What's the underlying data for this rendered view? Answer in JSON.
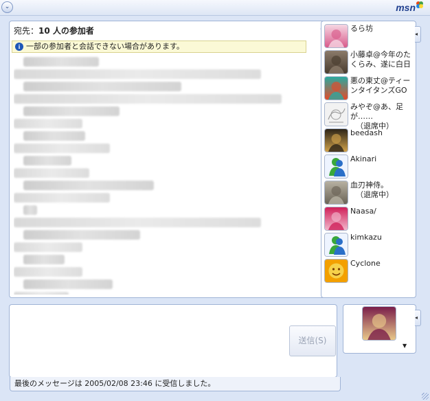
{
  "window": {
    "menu_glyph": "⌄",
    "logo": "msn"
  },
  "conversation": {
    "to_prefix": "宛先：",
    "to_value": "10 人の参加者",
    "warning_icon_glyph": "i",
    "warning": "一部の参加者と会話できない場合があります。"
  },
  "participants": [
    {
      "name": "るら坊",
      "status": "",
      "avatar": "anime-girl-pink-hair-icon",
      "colors": [
        "#f6d7e3",
        "#d85b8b"
      ]
    },
    {
      "name": "小藤卓@今年のたくらみ、遂に白日",
      "status": "",
      "avatar": "photo-scene-icon",
      "colors": [
        "#8b7a6a",
        "#4a3d30"
      ]
    },
    {
      "name": "悪の東丈@ティーンタイタンズGO",
      "status": "",
      "avatar": "cartoon-character-icon",
      "colors": [
        "#2aa9a0",
        "#e34a2a"
      ]
    },
    {
      "name": "みやぞ@あ、足が……",
      "status": "（退席中）",
      "avatar": "sketch-drawing-icon",
      "colors": [
        "#f2f2f2",
        "#9a9a9a"
      ]
    },
    {
      "name": "beedash",
      "status": "",
      "avatar": "pharaoh-mask-icon",
      "colors": [
        "#2c2418",
        "#d0a24a"
      ]
    },
    {
      "name": "Akinari",
      "status": "",
      "avatar": "msn-buddy-icon",
      "colors": [
        "#3aa83a",
        "#2a6fc8"
      ]
    },
    {
      "name": "血刃神侍。",
      "status": "（退席中）",
      "avatar": "cat-photo-icon",
      "colors": [
        "#b7b1a2",
        "#6b6457"
      ]
    },
    {
      "name": "Naasa/",
      "status": "",
      "avatar": "anime-pink-art-icon",
      "colors": [
        "#d0205a",
        "#f1b6cb"
      ]
    },
    {
      "name": "kimkazu",
      "status": "",
      "avatar": "msn-buddy-icon",
      "colors": [
        "#3aa83a",
        "#2a6fc8"
      ]
    },
    {
      "name": "Cyclone",
      "status": "",
      "avatar": "sun-face-icon",
      "colors": [
        "#f3a000",
        "#f6d14a"
      ]
    }
  ],
  "input": {
    "send_label": "送信(S)"
  },
  "status_bar": {
    "text": "最後のメッセージは 2005/02/08 23:46 に受信しました。"
  },
  "my_picture": {
    "avatar": "anime-girl-blonde-icon",
    "colors": [
      "#7a1e4a",
      "#e9c98a"
    ]
  }
}
